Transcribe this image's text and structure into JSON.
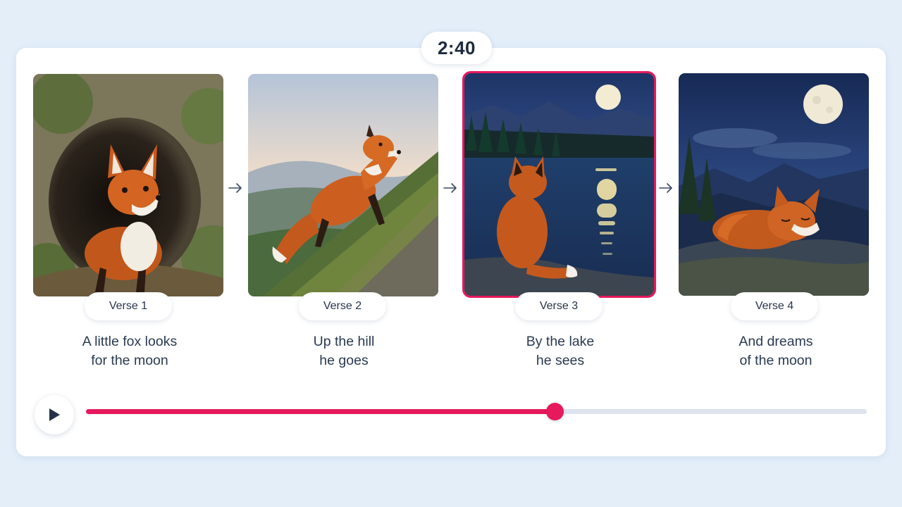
{
  "player": {
    "time": "2:40",
    "progress": 0.6,
    "accent_color": "#e6195c",
    "play_icon": "play-icon"
  },
  "verses": [
    {
      "label": "Verse 1",
      "lyric": [
        "A little fox looks",
        "for the moon"
      ],
      "scene": "fox peeking out of a rocky den"
    },
    {
      "label": "Verse 2",
      "lyric": [
        "Up the hill",
        "he goes"
      ],
      "scene": "fox climbing a grassy hillside at dusk"
    },
    {
      "label": "Verse 3",
      "lyric": [
        "By the lake",
        "he sees"
      ],
      "scene": "fox sitting by a moonlit lake",
      "active": true
    },
    {
      "label": "Verse 4",
      "lyric": [
        "And dreams",
        "of the moon"
      ],
      "scene": "fox sleeping on a rock under the full moon"
    }
  ],
  "separator_icon": "arrow-right-icon"
}
